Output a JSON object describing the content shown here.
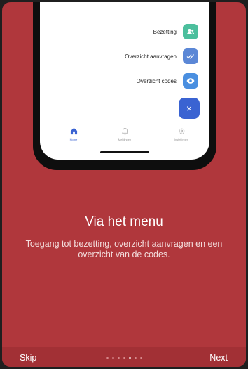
{
  "phone_screen": {
    "menu_items": [
      {
        "label": "Bezetting",
        "icon": "people-icon",
        "color": "#4cbf9d"
      },
      {
        "label": "Overzicht aanvragen",
        "icon": "double-check-icon",
        "color": "#5b87d6"
      },
      {
        "label": "Overzicht codes",
        "icon": "eye-icon",
        "color": "#4a8fe0"
      }
    ],
    "fab_symbol": "×",
    "fab_color": "#3a63d2",
    "tabs": [
      {
        "label": "Home",
        "icon": "home-icon",
        "active": true
      },
      {
        "label": "Meldingen",
        "icon": "bell-icon",
        "active": false
      },
      {
        "label": "Instellingen",
        "icon": "gear-icon",
        "active": false
      }
    ]
  },
  "onboarding": {
    "title": "Via het menu",
    "description": "Toegang tot bezetting, overzicht aanvragen en een overzicht van de codes.",
    "background_color": "#b0373c"
  },
  "footer": {
    "skip_label": "Skip",
    "next_label": "Next",
    "page_count": 7,
    "current_page": 5
  }
}
